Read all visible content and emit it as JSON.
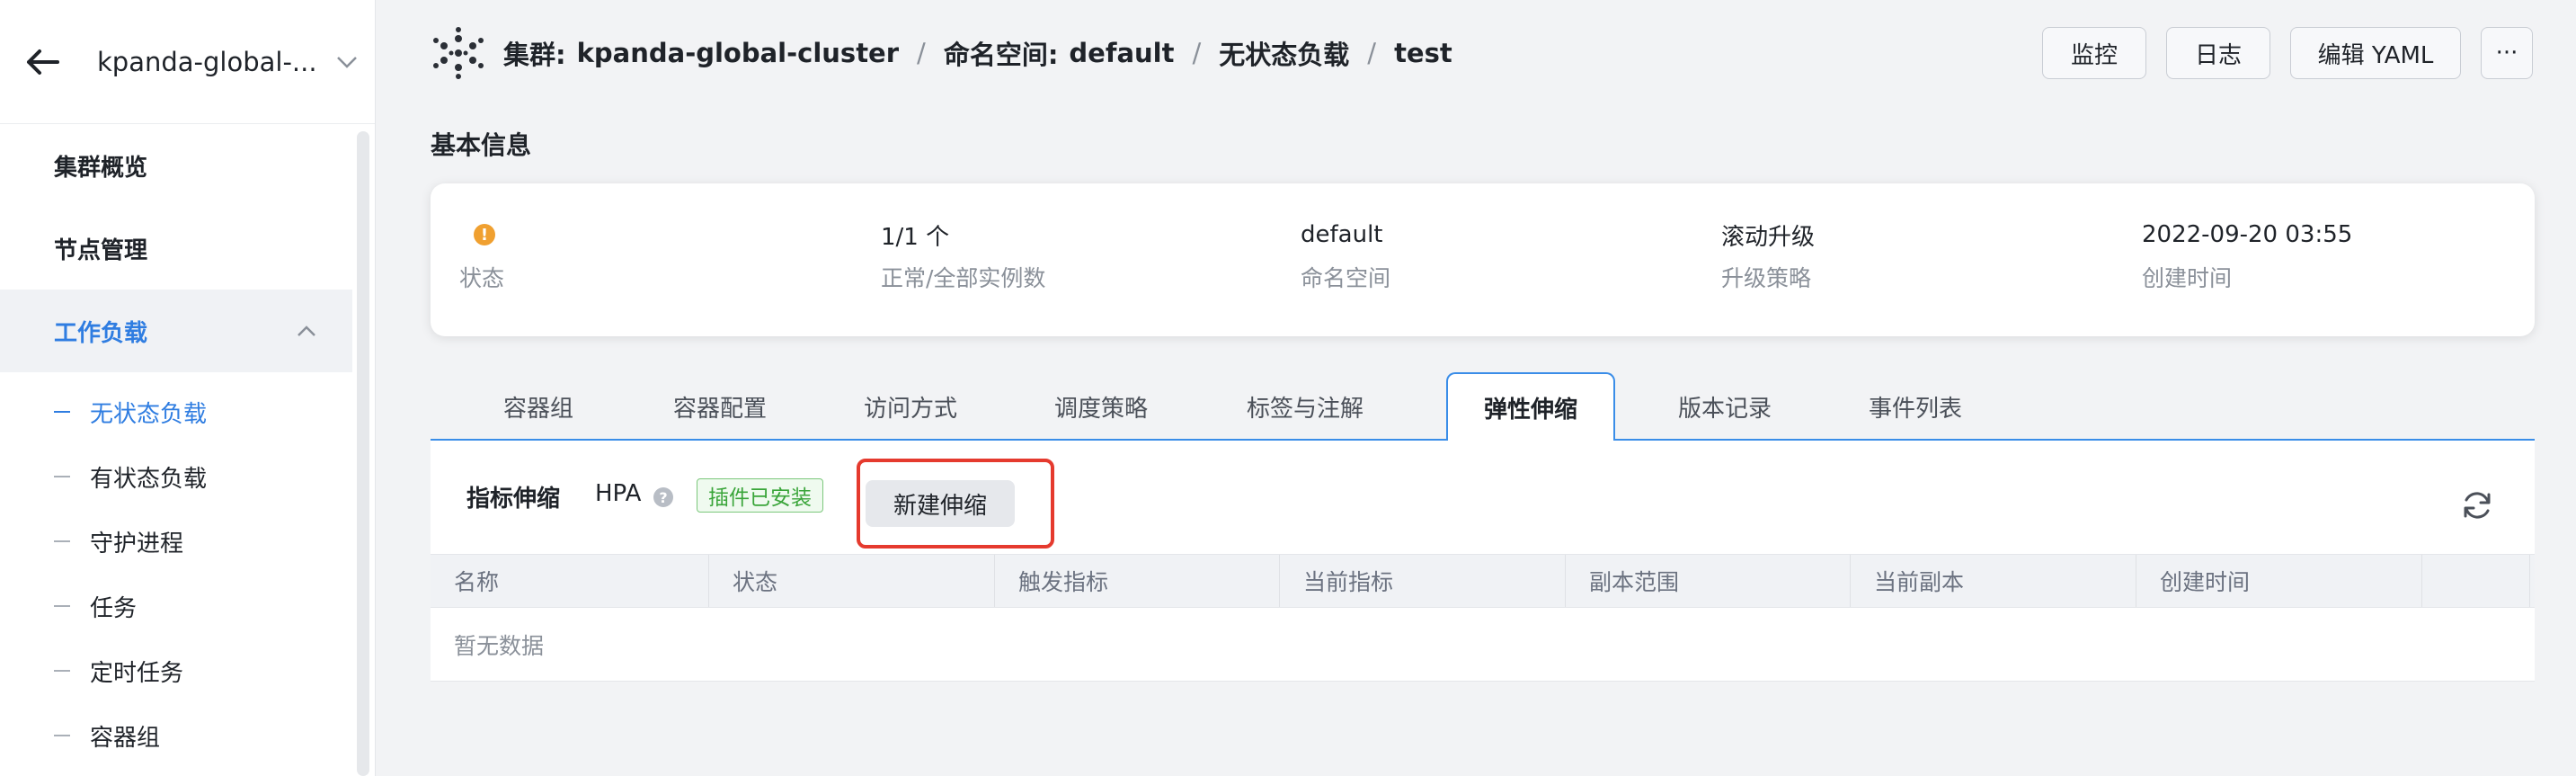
{
  "sidebar": {
    "cluster_name": "kpanda-global-...",
    "items": [
      {
        "label": "集群概览"
      },
      {
        "label": "节点管理"
      },
      {
        "label": "工作负载"
      }
    ],
    "sub_items": [
      {
        "label": "无状态负载"
      },
      {
        "label": "有状态负载"
      },
      {
        "label": "守护进程"
      },
      {
        "label": "任务"
      },
      {
        "label": "定时任务"
      },
      {
        "label": "容器组"
      }
    ]
  },
  "breadcrumb": {
    "cluster_prefix": "集群:",
    "cluster": "kpanda-global-cluster",
    "namespace_prefix": "命名空间:",
    "namespace": "default",
    "workload_type": "无状态负载",
    "workload": "test",
    "separator": "/"
  },
  "actions": {
    "monitor": "监控",
    "log": "日志",
    "edit_yaml": "编辑 YAML",
    "more": "···"
  },
  "basic_info": {
    "title": "基本信息",
    "status_label": "状态",
    "instances_value": "1/1 个",
    "instances_label": "正常/全部实例数",
    "namespace_value": "default",
    "namespace_label": "命名空间",
    "strategy_value": "滚动升级",
    "strategy_label": "升级策略",
    "created_value": "2022-09-20 03:55",
    "created_label": "创建时间"
  },
  "tabs": [
    {
      "label": "容器组"
    },
    {
      "label": "容器配置"
    },
    {
      "label": "访问方式"
    },
    {
      "label": "调度策略"
    },
    {
      "label": "标签与注解"
    },
    {
      "label": "弹性伸缩"
    },
    {
      "label": "版本记录"
    },
    {
      "label": "事件列表"
    }
  ],
  "hpa": {
    "title": "指标伸缩",
    "label": "HPA",
    "help": "?",
    "installed_tag": "插件已安装",
    "new_button": "新建伸缩"
  },
  "table": {
    "columns": [
      "名称",
      "状态",
      "触发指标",
      "当前指标",
      "副本范围",
      "当前副本",
      "创建时间"
    ],
    "empty_text": "暂无数据"
  },
  "colors": {
    "accent": "#2f7de1",
    "tab_border": "#3a8de8",
    "highlight": "#e53a2e",
    "status_warning": "#f0a030",
    "tag_green": "#3aa53a"
  },
  "icons": {
    "back": "arrow-left-icon",
    "dropdown": "chevron-down-icon",
    "collapse": "chevron-up-icon",
    "logo": "cluster-logo-icon",
    "status": "warning-icon",
    "help": "question-icon",
    "refresh": "refresh-icon"
  }
}
